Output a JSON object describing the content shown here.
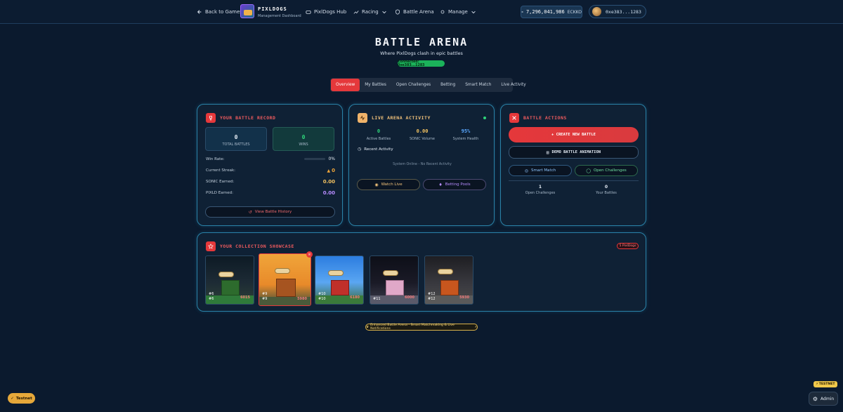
{
  "nav": {
    "back": "Back to Games",
    "brand_title": "PIXLDOGS",
    "brand_sub": "Management Dashboard",
    "hub": "PixlDogs Hub",
    "racing": "Racing",
    "battle_arena": "Battle Arena",
    "manage": "Manage",
    "balance": "7,296,041,986",
    "balance_unit": "ECKKO",
    "wallet": "0xe383...1283"
  },
  "header": {
    "title": "BATTLE ARENA",
    "subtitle": "Where PixlDogs clash in epic battles",
    "connected": "Connected: 0xe383...1283"
  },
  "tabs": [
    "Overview",
    "My Battles",
    "Open Challenges",
    "Betting",
    "Smart Match",
    "Live Activity"
  ],
  "record": {
    "title": "YOUR BATTLE RECORD",
    "total_battles_value": "0",
    "total_battles_label": "TOTAL BATTLES",
    "wins_value": "0",
    "wins_label": "WINS",
    "win_rate_label": "Win Rate:",
    "win_rate_value": "0%",
    "streak_label": "Current Streak:",
    "streak_value": "0",
    "sonic_label": "SONIC Earned:",
    "sonic_value": "0.00",
    "pixld_label": "PIXLD Earned:",
    "pixld_value": "0.00",
    "history_button": "View Battle History"
  },
  "activity": {
    "title": "LIVE ARENA ACTIVITY",
    "active_value": "0",
    "active_label": "Active Battles",
    "volume_value": "0.00",
    "volume_label": "SONIC Volume",
    "health_value": "95%",
    "health_label": "System Health",
    "recent_label": "Recent Activity",
    "empty_text": "System Online - No Recent Activity",
    "watch_button": "Watch Live",
    "pools_button": "Betting Pools"
  },
  "actions": {
    "title": "BATTLE ACTIONS",
    "create_button": "+ CREATE NEW BATTLE",
    "demo_button": "DEMO BATTLE ANIMATION",
    "smart_button": "Smart Match",
    "open_button": "Open Challenges",
    "open_count": "1",
    "open_label": "Open Challenges",
    "your_count": "0",
    "your_label": "Your Battles"
  },
  "showcase": {
    "title": "YOUR COLLECTION SHOWCASE",
    "badge": "5 PixlDogs",
    "cards": [
      {
        "id_top": "#6",
        "id_bottom": "#6",
        "score": "6015"
      },
      {
        "id_top": "#9",
        "id_bottom": "#9",
        "score": "5980"
      },
      {
        "id_top": "#10",
        "id_bottom": "#10",
        "score": "6180"
      },
      {
        "id_top": "#11",
        "id_bottom": "#11",
        "score": "6000"
      },
      {
        "id_top": "#12",
        "id_bottom": "#12",
        "score": "5930"
      }
    ]
  },
  "footer": {
    "badge": "Enhanced Battle Arena - Smart Matchmaking & Live Notifications",
    "testnet_button": "Testnet",
    "testnet_tag": "TESTNET",
    "admin_button": "Admin"
  },
  "colors": {
    "accent_red": "#e5383b",
    "panel_border": "#2a82a8",
    "win_green": "#2ed47a",
    "sonic_orange": "#f0a53a",
    "pixld_purple": "#b78cff"
  }
}
